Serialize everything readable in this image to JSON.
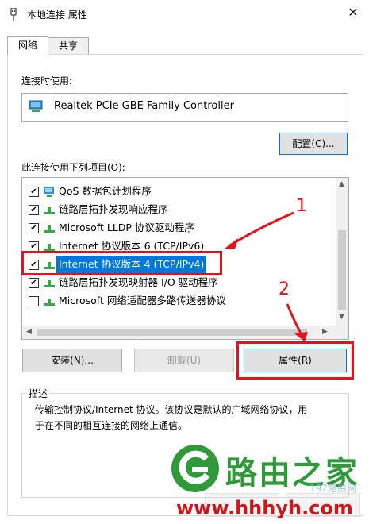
{
  "window": {
    "title": "本地连接 属性",
    "close_symbol": "✕"
  },
  "tabs": [
    {
      "label": "网络"
    },
    {
      "label": "共享"
    }
  ],
  "connect_using": {
    "label": "连接时使用:",
    "adapter": "Realtek PCIe GBE Family Controller"
  },
  "configure_button": "配置(C)...",
  "items_label": "此连接使用下列项目(O):",
  "items": [
    {
      "label": "QoS 数据包计划程序",
      "checked": true
    },
    {
      "label": "链路层拓扑发现响应程序",
      "checked": true
    },
    {
      "label": "Microsoft LLDP 协议驱动程序",
      "checked": true
    },
    {
      "label": "Internet 协议版本 6 (TCP/IPv6)",
      "checked": true
    },
    {
      "label": "Internet 协议版本 4 (TCP/IPv4)",
      "checked": true,
      "selected": true
    },
    {
      "label": "链路层拓扑发现映射器 I/O 驱动程序",
      "checked": true
    },
    {
      "label": "Microsoft 网络适配器多路传送器协议",
      "checked": false
    }
  ],
  "buttons": {
    "install": "安装(N)...",
    "uninstall": "卸载(U)",
    "properties": "属性(R)"
  },
  "description": {
    "label": "描述",
    "line1": "传输控制协议/Internet 协议。该协议是默认的广域网络协议，用",
    "line2": "于在不同的相互连接的网络上通信。"
  },
  "annotations": {
    "marker1": "1",
    "marker2": "2"
  },
  "watermark": {
    "brand": "路由之家",
    "url": "www.hhhyh.com",
    "small": "192路由网"
  },
  "colors": {
    "highlight": "#0078d7",
    "annotation_red": "#e0141a",
    "watermark_green": "#2e9a3a"
  }
}
